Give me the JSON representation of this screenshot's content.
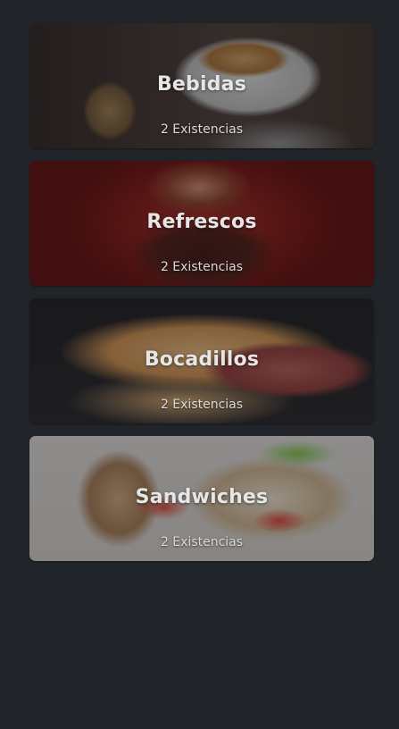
{
  "categories": [
    {
      "name": "Bebidas",
      "stock": "2 Existencias"
    },
    {
      "name": "Refrescos",
      "stock": "2 Existencias"
    },
    {
      "name": "Bocadillos",
      "stock": "2 Existencias"
    },
    {
      "name": "Sandwiches",
      "stock": "2 Existencias"
    }
  ]
}
